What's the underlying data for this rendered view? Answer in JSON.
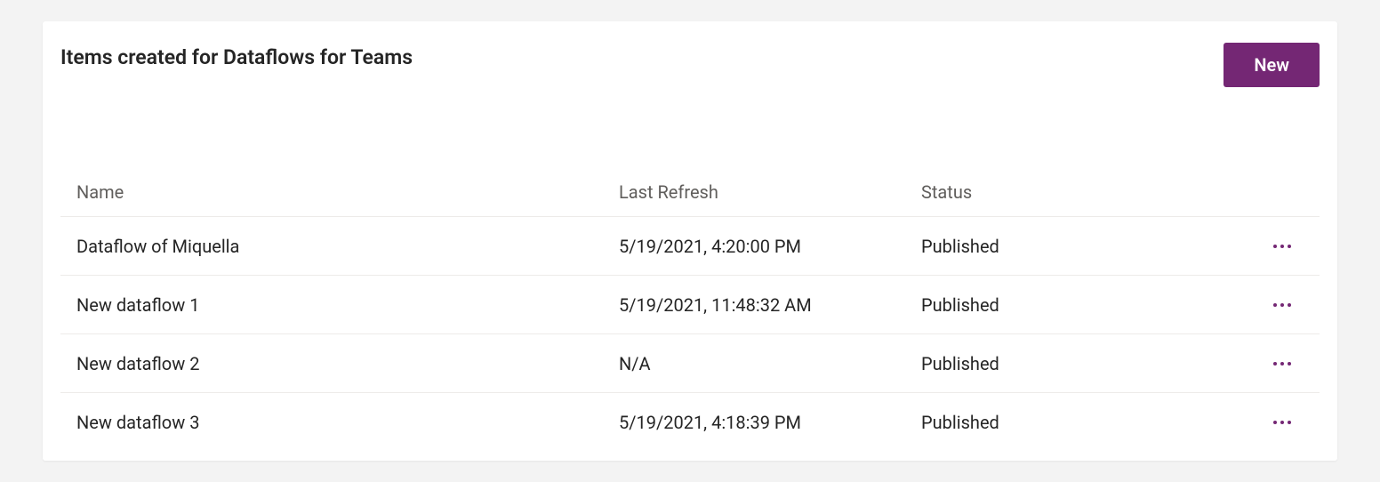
{
  "header": {
    "title": "Items created for Dataflows for Teams",
    "new_button_label": "New"
  },
  "columns": {
    "name": "Name",
    "last_refresh": "Last Refresh",
    "status": "Status"
  },
  "rows": [
    {
      "name": "Dataflow of Miquella",
      "last_refresh": "5/19/2021, 4:20:00 PM",
      "status": "Published"
    },
    {
      "name": "New dataflow 1",
      "last_refresh": "5/19/2021, 11:48:32 AM",
      "status": "Published"
    },
    {
      "name": "New dataflow 2",
      "last_refresh": "N/A",
      "status": "Published"
    },
    {
      "name": "New dataflow 3",
      "last_refresh": "5/19/2021, 4:18:39 PM",
      "status": "Published"
    }
  ],
  "colors": {
    "accent": "#742774"
  }
}
